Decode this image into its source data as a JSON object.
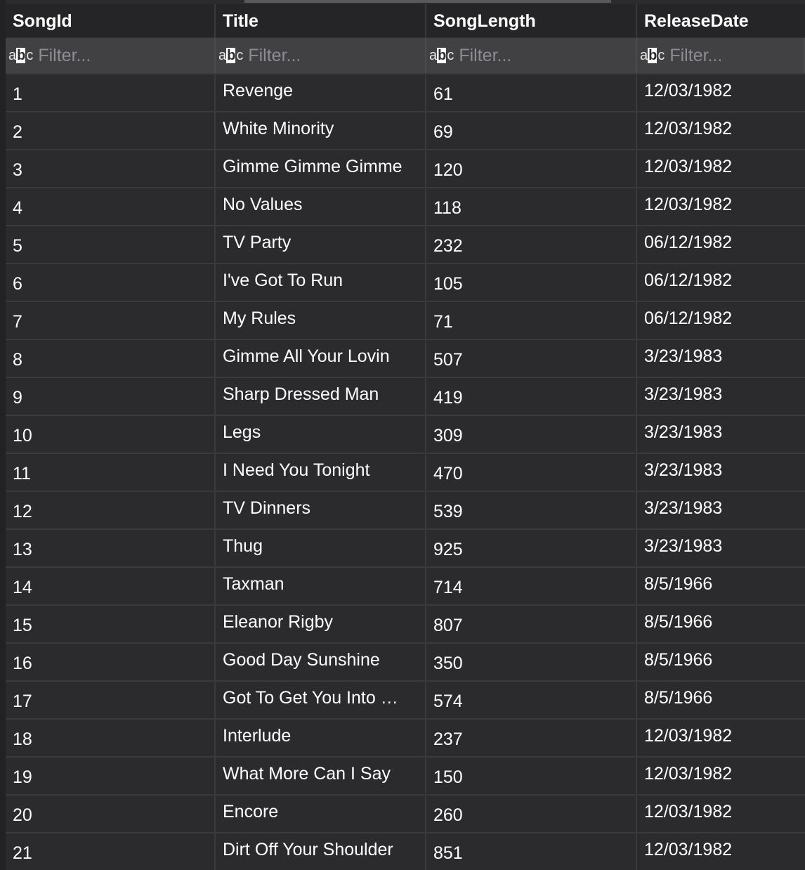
{
  "columns": [
    {
      "name": "SongId",
      "filter_placeholder": "Filter...",
      "filter_icon": "abc-type-icon"
    },
    {
      "name": "Title",
      "filter_placeholder": "Filter...",
      "filter_icon": "abc-type-icon"
    },
    {
      "name": "SongLength",
      "filter_placeholder": "Filter...",
      "filter_icon": "abc-type-icon"
    },
    {
      "name": "ReleaseDate",
      "filter_placeholder": "Filter...",
      "filter_icon": "abc-type-icon"
    }
  ],
  "filter_icon_text": {
    "a": "a",
    "b": "b",
    "c": "c"
  },
  "rows": [
    [
      "1",
      "Revenge",
      "61",
      "12/03/1982"
    ],
    [
      "2",
      "White Minority",
      "69",
      "12/03/1982"
    ],
    [
      "3",
      "Gimme Gimme Gimme",
      "120",
      "12/03/1982"
    ],
    [
      "4",
      "No Values",
      "118",
      "12/03/1982"
    ],
    [
      "5",
      "TV Party",
      "232",
      "06/12/1982"
    ],
    [
      "6",
      "I've Got To Run",
      "105",
      "06/12/1982"
    ],
    [
      "7",
      "My Rules",
      "71",
      "06/12/1982"
    ],
    [
      "8",
      "Gimme All Your Lovin",
      "507",
      "3/23/1983"
    ],
    [
      "9",
      "Sharp Dressed Man",
      "419",
      "3/23/1983"
    ],
    [
      "10",
      "Legs",
      "309",
      "3/23/1983"
    ],
    [
      "11",
      "I Need You Tonight",
      "470",
      "3/23/1983"
    ],
    [
      "12",
      "TV Dinners",
      "539",
      "3/23/1983"
    ],
    [
      "13",
      "Thug",
      "925",
      "3/23/1983"
    ],
    [
      "14",
      "Taxman",
      "714",
      "8/5/1966"
    ],
    [
      "15",
      "Eleanor Rigby",
      "807",
      "8/5/1966"
    ],
    [
      "16",
      "Good Day Sunshine",
      "350",
      "8/5/1966"
    ],
    [
      "17",
      "Got To Get You Into …",
      "574",
      "8/5/1966"
    ],
    [
      "18",
      "Interlude",
      "237",
      "12/03/1982"
    ],
    [
      "19",
      "What More Can I Say",
      "150",
      "12/03/1982"
    ],
    [
      "20",
      "Encore",
      "260",
      "12/03/1982"
    ],
    [
      "21",
      "Dirt Off Your Shoulder",
      "851",
      "12/03/1982"
    ]
  ],
  "colors": {
    "background": "#2b2b2d",
    "header_bg": "#252527",
    "filter_bg": "#414144",
    "grid_line": "#3a3a3d",
    "text": "#ffffff",
    "placeholder": "#8d8d92"
  }
}
